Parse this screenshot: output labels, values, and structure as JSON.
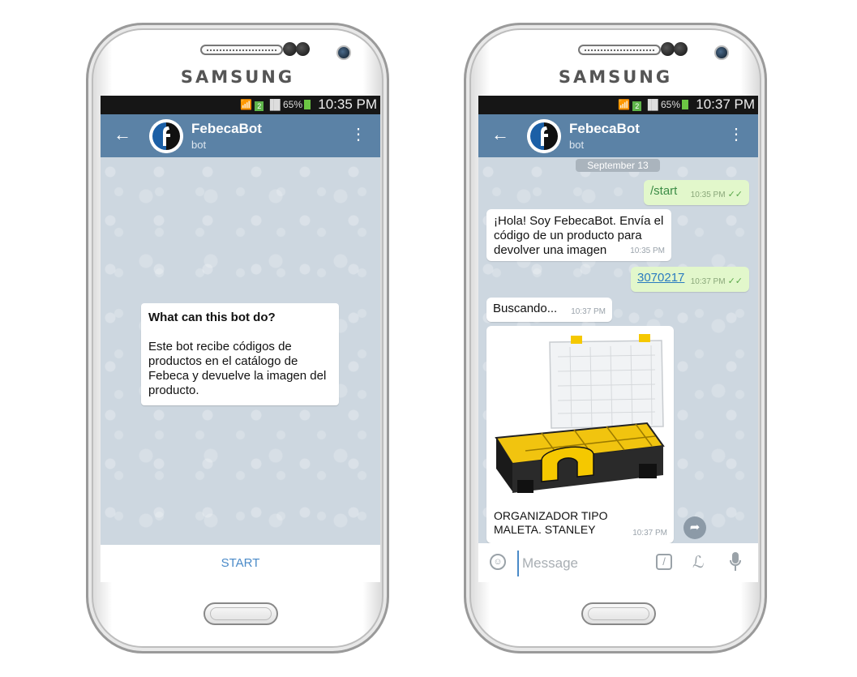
{
  "phones": [
    {
      "brand": "SAMSUNG",
      "status": {
        "signal_badge": "2",
        "battery": "65%",
        "time": "10:35 PM"
      },
      "header": {
        "name": "FebecaBot",
        "subtitle": "bot"
      },
      "info_card": {
        "title": "What can this bot do?",
        "body": "Este bot recibe códigos de productos en el catálogo de Febeca y devuelve la imagen del producto."
      },
      "start_label": "START"
    },
    {
      "brand": "SAMSUNG",
      "status": {
        "signal_badge": "2",
        "battery": "65%",
        "time": "10:37 PM"
      },
      "header": {
        "name": "FebecaBot",
        "subtitle": "bot"
      },
      "date_divider": "September 13",
      "messages": [
        {
          "dir": "out",
          "text": "/start",
          "time": "10:35 PM",
          "checks": "✓✓"
        },
        {
          "dir": "in",
          "text": "¡Hola! Soy FebecaBot. Envía el código de un producto para devolver una imagen",
          "time": "10:35 PM"
        },
        {
          "dir": "out",
          "text": "3070217",
          "time": "10:37 PM",
          "checks": "✓✓"
        },
        {
          "dir": "in",
          "text": "Buscando...",
          "time": "10:37 PM"
        },
        {
          "dir": "in",
          "text": "ORGANIZADOR TIPO MALETA. STANLEY",
          "time": "10:37 PM"
        }
      ],
      "input": {
        "placeholder": "Message"
      }
    }
  ],
  "icons": {
    "back": "arrow-left-icon",
    "menu": "more-vertical-icon",
    "emoji": "smiley-icon",
    "command": "slash-command-icon",
    "attach": "paperclip-icon",
    "mic": "microphone-icon",
    "share": "forward-icon"
  },
  "colors": {
    "app_bar": "#5b82a6",
    "outgoing_bubble": "#e2f7cb",
    "incoming_bubble": "#ffffff",
    "accent": "#4a8ac8"
  }
}
